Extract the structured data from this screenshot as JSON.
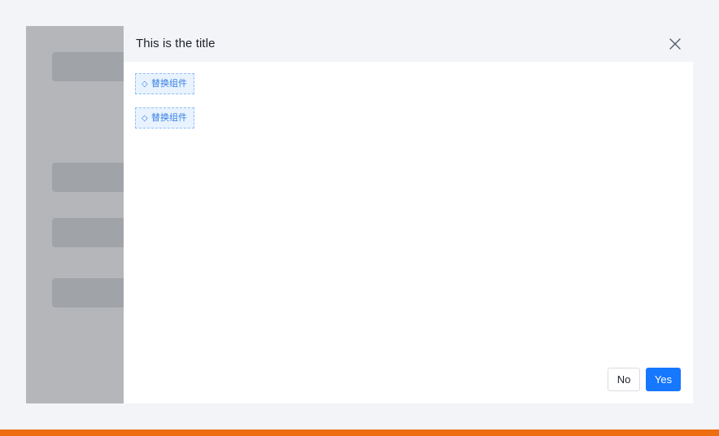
{
  "dialog": {
    "title": "This is the title",
    "close_icon": "close-icon",
    "placeholders": [
      {
        "icon": "◇",
        "label": "替换组件"
      },
      {
        "icon": "◇",
        "label": "替换组件"
      }
    ],
    "buttons": {
      "no_label": "No",
      "yes_label": "Yes"
    }
  },
  "colors": {
    "primary": "#1677ff",
    "accent_strip": "#ee6d11",
    "overlay": "#b4b6ba",
    "placeholder_border": "#94bff5",
    "placeholder_bg": "#e8f3ff"
  }
}
